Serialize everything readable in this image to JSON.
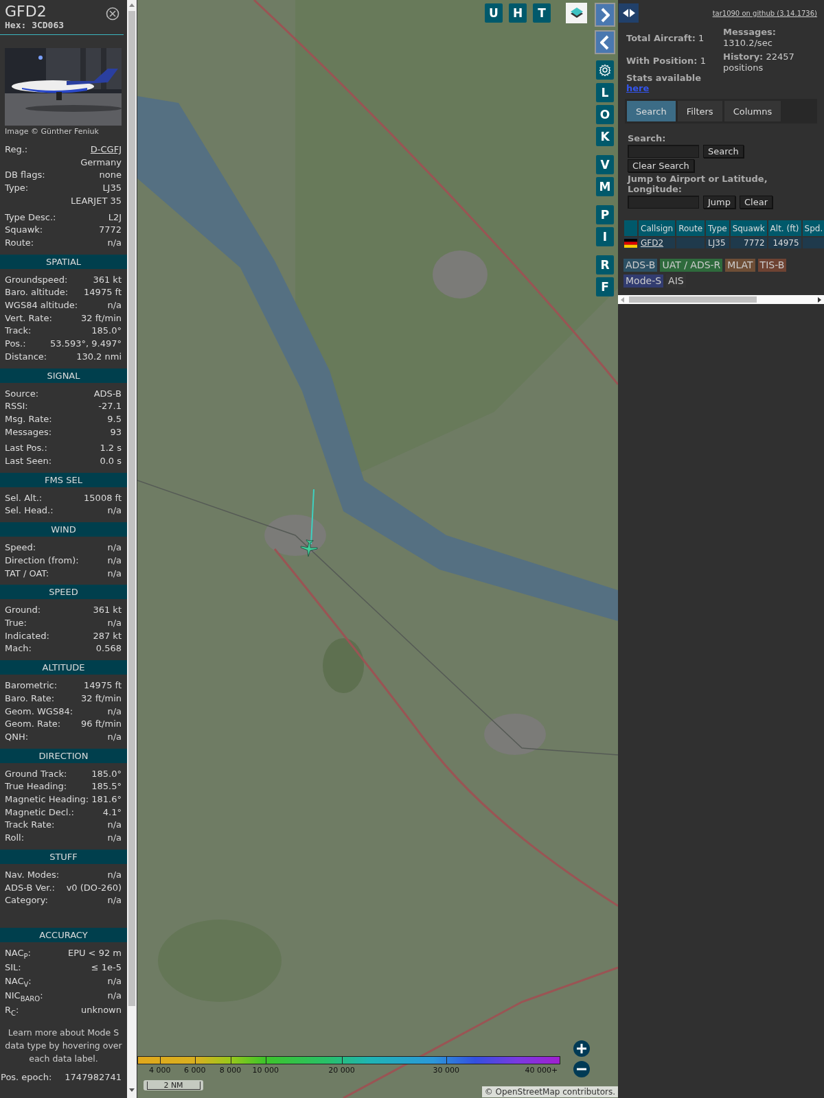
{
  "sidebar": {
    "callsign": "GFD2",
    "hex": "Hex: 3CD063",
    "photo_credit": "Image © Günther Feniuk",
    "details": [
      [
        {
          "label": "Reg.:",
          "value": "D-CGFJ",
          "kind": "link"
        },
        {
          "value": "Germany",
          "kind": "text"
        },
        {
          "label": "DB flags:",
          "value": "none",
          "kind": "text"
        },
        {
          "label": "Type:",
          "value": "LJ35",
          "kind": "text"
        },
        {
          "value": "LEARJET 35",
          "kind": "text"
        }
      ],
      [
        {
          "label": "Type Desc.:",
          "value": "L2J",
          "kind": "text"
        },
        {
          "label": "Squawk:",
          "value": "7772",
          "kind": "text"
        },
        {
          "label": "Route:",
          "value": "n/a",
          "kind": "text"
        }
      ]
    ],
    "sections": [
      {
        "title": "SPATIAL",
        "groups": [
          [
            {
              "label": "Groundspeed:",
              "value": "361 kt"
            },
            {
              "label": "Baro. altitude:",
              "value": "14975 ft"
            },
            {
              "label": "WGS84 altitude:",
              "value": "n/a"
            },
            {
              "label": "Vert. Rate:",
              "value": "32 ft/min"
            },
            {
              "label": "Track:",
              "value": "185.0°"
            },
            {
              "label": "Pos.:",
              "value": "53.593°, 9.497°"
            },
            {
              "label": "Distance:",
              "value": "130.2 nmi"
            }
          ]
        ]
      },
      {
        "title": "SIGNAL",
        "groups": [
          [
            {
              "label": "Source:",
              "value": "ADS-B"
            },
            {
              "label": "RSSI:",
              "value": "-27.1"
            },
            {
              "label": "Msg. Rate:",
              "value": "9.5"
            },
            {
              "label": "Messages:",
              "value": "93"
            }
          ],
          [
            {
              "label": "Last Pos.:",
              "value": "1.2 s"
            },
            {
              "label": "Last Seen:",
              "value": "0.0 s"
            }
          ]
        ]
      },
      {
        "title": "FMS SEL",
        "groups": [
          [
            {
              "label": "Sel. Alt.:",
              "value": "15008 ft"
            },
            {
              "label": "Sel. Head.:",
              "value": "n/a"
            }
          ]
        ]
      },
      {
        "title": "WIND",
        "groups": [
          [
            {
              "label": "Speed:",
              "value": "n/a"
            },
            {
              "label": "Direction (from):",
              "value": "n/a"
            },
            {
              "label": "TAT / OAT:",
              "value": "n/a"
            }
          ]
        ]
      },
      {
        "title": "SPEED",
        "groups": [
          [
            {
              "label": "Ground:",
              "value": "361 kt"
            },
            {
              "label": "True:",
              "value": "n/a"
            },
            {
              "label": "Indicated:",
              "value": "287 kt"
            },
            {
              "label": "Mach:",
              "value": "0.568"
            }
          ]
        ]
      },
      {
        "title": "ALTITUDE",
        "groups": [
          [
            {
              "label": "Barometric:",
              "value": "14975 ft"
            },
            {
              "label": "Baro. Rate:",
              "value": "32 ft/min"
            },
            {
              "label": "Geom. WGS84:",
              "value": "n/a"
            },
            {
              "label": "Geom. Rate:",
              "value": "96 ft/min"
            },
            {
              "label": "QNH:",
              "value": "n/a"
            }
          ]
        ]
      },
      {
        "title": "DIRECTION",
        "groups": [
          [
            {
              "label": "Ground Track:",
              "value": "185.0°"
            },
            {
              "label": "True Heading:",
              "value": "185.5°"
            },
            {
              "label": "Magnetic Heading:",
              "value": "181.6°"
            },
            {
              "label": "Magnetic Decl.:",
              "value": "4.1°"
            },
            {
              "label": "Track Rate:",
              "value": "n/a"
            },
            {
              "label": "Roll:",
              "value": "n/a"
            }
          ]
        ]
      },
      {
        "title": "STUFF",
        "groups": [
          [
            {
              "label": "Nav. Modes:",
              "value": "n/a"
            },
            {
              "label": "ADS-B Ver.:",
              "value": "v0 (DO-260)"
            },
            {
              "label": "Category:",
              "value": "n/a"
            }
          ]
        ]
      }
    ],
    "accuracy": {
      "title": "ACCURACY",
      "rows": [
        {
          "label": "NAC$_{P}$:",
          "value": "EPU < 92 m"
        },
        {
          "label": "SIL:",
          "value": "≤ 1e-5"
        },
        {
          "label": "NAC$_{V}$:",
          "value": "n/a"
        },
        {
          "label": "NIC$_{BARO}$:",
          "value": "n/a"
        },
        {
          "label": "R$_{C}$:",
          "value": "unknown"
        }
      ]
    },
    "note": "Learn more about Mode S data type by hovering over each data label.",
    "epoch": {
      "label": "Pos. epoch:",
      "value": "1747982741"
    }
  },
  "map": {
    "top_buttons": [
      "U",
      "H",
      "T"
    ],
    "side_buttons": [
      [
        "L",
        "O",
        "K"
      ],
      [
        "V",
        "M"
      ],
      [
        "P",
        "I"
      ],
      [
        "R",
        "F"
      ]
    ],
    "altitude_legend": [
      "4 000",
      "6 000",
      "8 000",
      "10 000",
      "20 000",
      "30 000",
      "40 000+"
    ],
    "scale": "2 NM",
    "attribution": {
      "prefix": "©",
      "link": "OpenStreetMap",
      "suffix": "contributors."
    }
  },
  "right_panel": {
    "github_link": "tar1090 on github (3.14.1736)",
    "stats_left": [
      "**Total Aircraft:** 1",
      "**With Position:** 1"
    ],
    "stats_right": [
      "**Messages:** 1310.2/sec",
      "**History:** 22457 positions"
    ],
    "stats_available": "Stats available",
    "stats_link": "here",
    "tabs": [
      {
        "label": "Search",
        "selected": true
      },
      {
        "label": "Filters",
        "selected": false
      },
      {
        "label": "Columns",
        "selected": false
      }
    ],
    "search": {
      "label": "Search:",
      "button": "Search",
      "clear_button": "Clear Search"
    },
    "jump": {
      "label": "Jump to Airport or Latitude, Longitude:",
      "button": "Jump",
      "clear_button": "Clear"
    },
    "table": {
      "columns": [
        "Callsign",
        "Route",
        "Type",
        "Squawk",
        "Alt. (ft)",
        "Spd."
      ],
      "rows": [
        {
          "callsign": "GFD2",
          "type": "LJ35",
          "squawk": "7772",
          "altitude": "14975"
        }
      ]
    },
    "sources": [
      {
        "label": "ADS-B",
        "color": "#2c5064"
      },
      {
        "label": "UAT / ADS-R",
        "color": "#2e6a3c"
      },
      {
        "label": "MLAT",
        "color": "#6e4e36"
      },
      {
        "label": "TIS-B",
        "color": "#6e4232"
      },
      {
        "label": "Mode-S",
        "color": "#323c70"
      },
      {
        "label": "AIS",
        "color": "#333333"
      }
    ]
  }
}
